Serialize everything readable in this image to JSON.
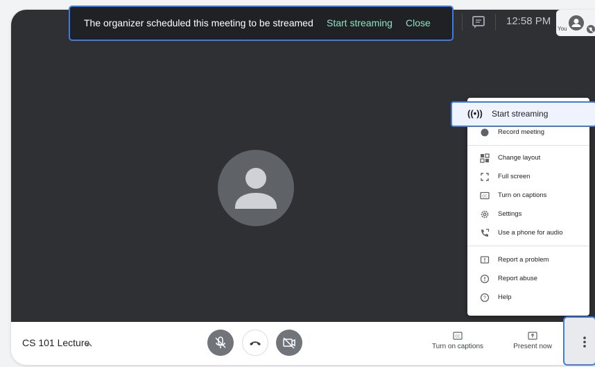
{
  "banner": {
    "message": "The organizer scheduled this meeting to be streamed",
    "start_label": "Start streaming",
    "close_label": "Close"
  },
  "status": {
    "time": "12:58 PM",
    "self_label": "You"
  },
  "menu": {
    "highlighted": {
      "label": "Start streaming",
      "icon": "broadcast-icon",
      "icon_glyph": "((•))"
    },
    "items": [
      {
        "label": "Record meeting",
        "icon": "record-icon"
      },
      {
        "label": "Change layout",
        "icon": "layout-icon"
      },
      {
        "label": "Full screen",
        "icon": "fullscreen-icon"
      },
      {
        "label": "Turn on captions",
        "icon": "captions-icon"
      },
      {
        "label": "Settings",
        "icon": "settings-icon"
      },
      {
        "label": "Use a phone for audio",
        "icon": "phone-icon"
      },
      {
        "label": "Report a problem",
        "icon": "report-problem-icon"
      },
      {
        "label": "Report abuse",
        "icon": "report-abuse-icon"
      },
      {
        "label": "Help",
        "icon": "help-icon"
      }
    ]
  },
  "bottom_bar": {
    "meeting_name": "CS 101 Lecture",
    "captions_label": "Turn on captions",
    "present_label": "Present now"
  },
  "colors": {
    "accent_blue": "#3d7be0",
    "banner_link": "#8ee2c1",
    "video_bg": "#2e3033",
    "banner_bg": "#202124"
  }
}
